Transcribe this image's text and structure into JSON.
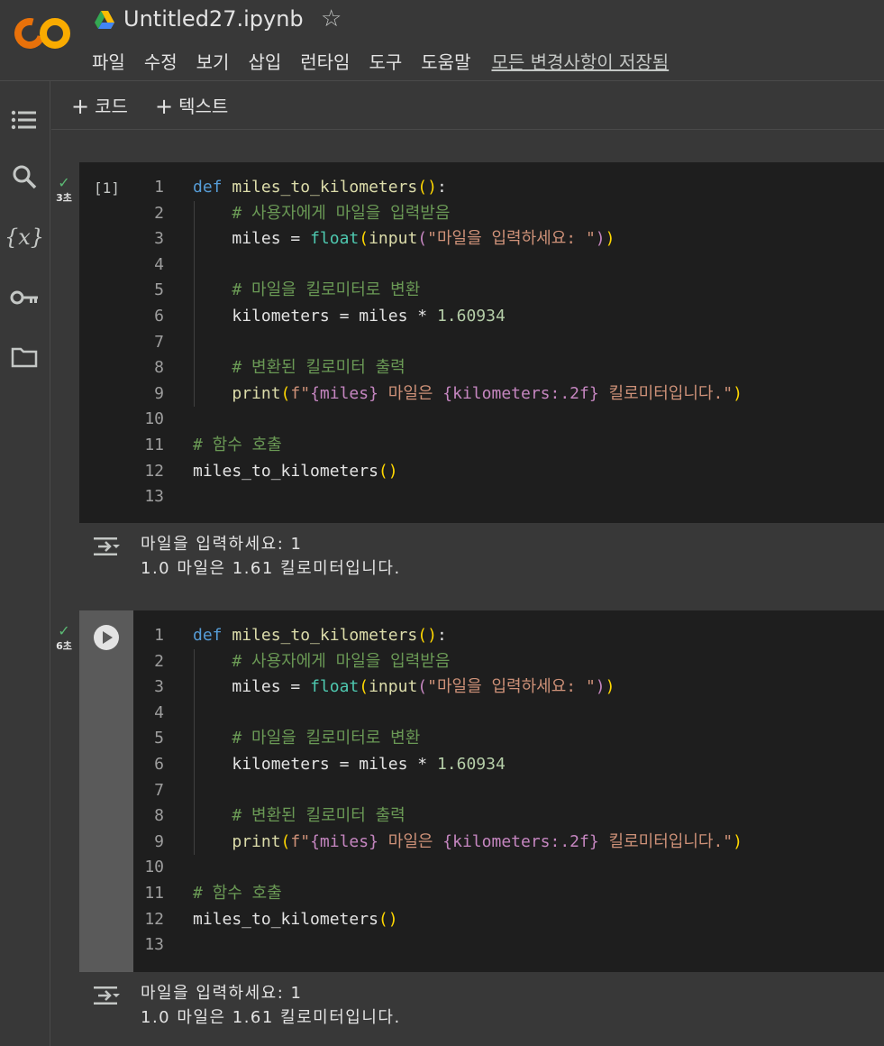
{
  "app": {
    "file_title": "Untitled27.ipynb",
    "menu": [
      "파일",
      "수정",
      "보기",
      "삽입",
      "런타임",
      "도구",
      "도움말"
    ],
    "save_status": "모든 변경사항이 저장됨"
  },
  "toolbar": {
    "add_code": "코드",
    "add_text": "텍스트"
  },
  "sidebar": {
    "icons": [
      "table-of-contents-icon",
      "search-icon",
      "variables-icon",
      "secrets-key-icon",
      "files-folder-icon"
    ],
    "variables_label": "{x}"
  },
  "cells": [
    {
      "exec_count": "[1]",
      "duration": "3초",
      "status": "success",
      "output_lines": [
        "마일을 입력하세요: 1",
        "1.0 마일은 1.61 킬로미터입니다."
      ]
    },
    {
      "exec_count": "",
      "duration": "6초",
      "status": "success",
      "output_lines": [
        "마일을 입력하세요: 1",
        "1.0 마일은 1.61 킬로미터입니다."
      ]
    }
  ],
  "code": {
    "line_numbers": [
      "1",
      "2",
      "3",
      "4",
      "5",
      "6",
      "7",
      "8",
      "9",
      "10",
      "11",
      "12",
      "13"
    ],
    "def_kw": "def",
    "func_name": "miles_to_kilometers",
    "comment1": "# 사용자에게 마일을 입력받음",
    "miles_var": "miles = ",
    "float_fn": "float",
    "input_fn": "input",
    "prompt_str": "\"마일을 입력하세요: \"",
    "comment2": "# 마일을 킬로미터로 변환",
    "km_assign": "kilometers = miles * ",
    "factor": "1.60934",
    "comment3": "# 변환된 킬로미터 출력",
    "print_fn": "print",
    "fstr_prefix": "f\"",
    "fv_miles": "{miles}",
    "fstr_mid": " 마일은 ",
    "fv_km": "{kilometers:.2f}",
    "fstr_end": " 킬로미터입니다.\"",
    "comment4": "# 함수 호출",
    "call": "miles_to_kilometers"
  }
}
